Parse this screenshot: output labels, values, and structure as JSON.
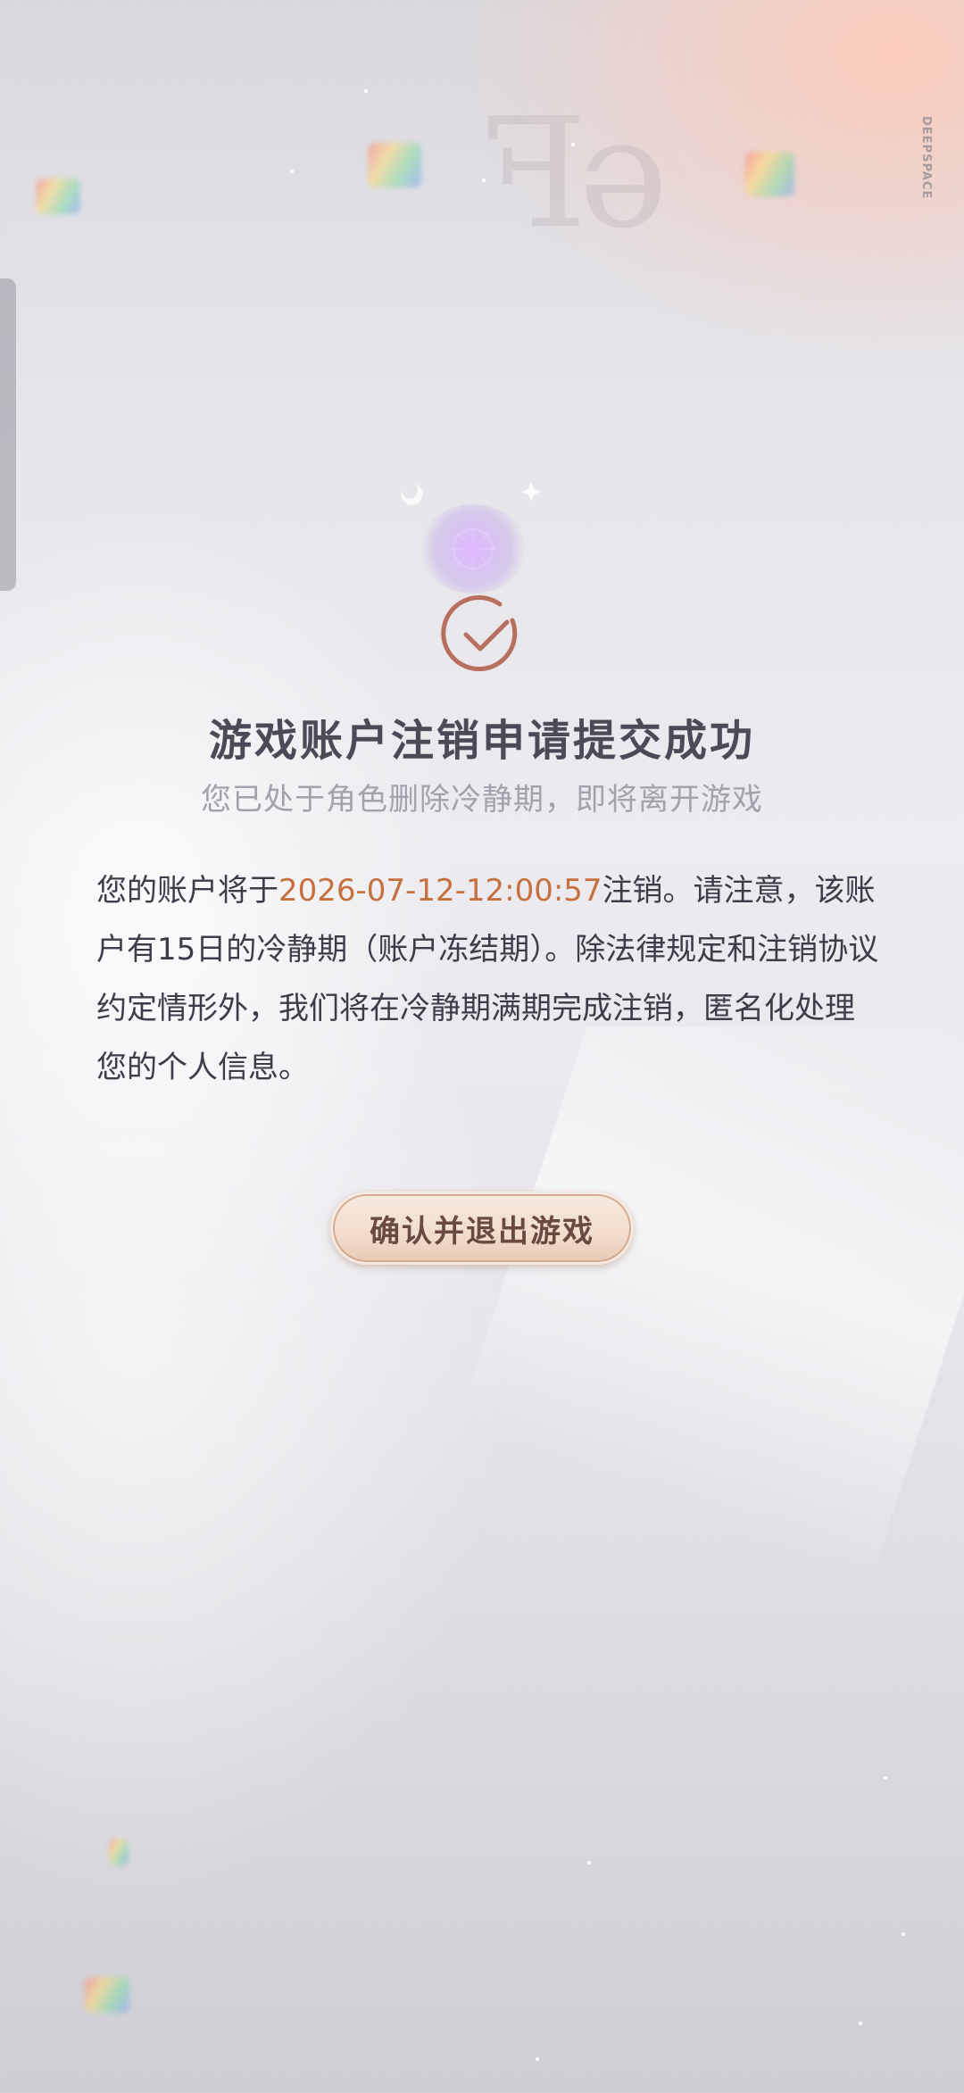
{
  "background": {
    "brand_text": "DEEPSPACE"
  },
  "dialog": {
    "title": "游戏账户注销申请提交成功",
    "subtitle": "您已处于角色删除冷静期，即将离开游戏",
    "body_prefix": "您的账户将于",
    "deletion_time": "2026-07-12-12:00:57",
    "body_suffix": "注销。请注意，该账户有15日的冷静期（账户冻结期）。除法律规定和注销协议约定情形外，我们将在冷静期满期完成注销，匿名化处理您的个人信息。"
  },
  "actions": {
    "confirm_exit_label": "确认并退出游戏"
  },
  "colors": {
    "highlight": "#c5703e",
    "check_icon": "#b86f5e",
    "title": "#4a4b57"
  }
}
